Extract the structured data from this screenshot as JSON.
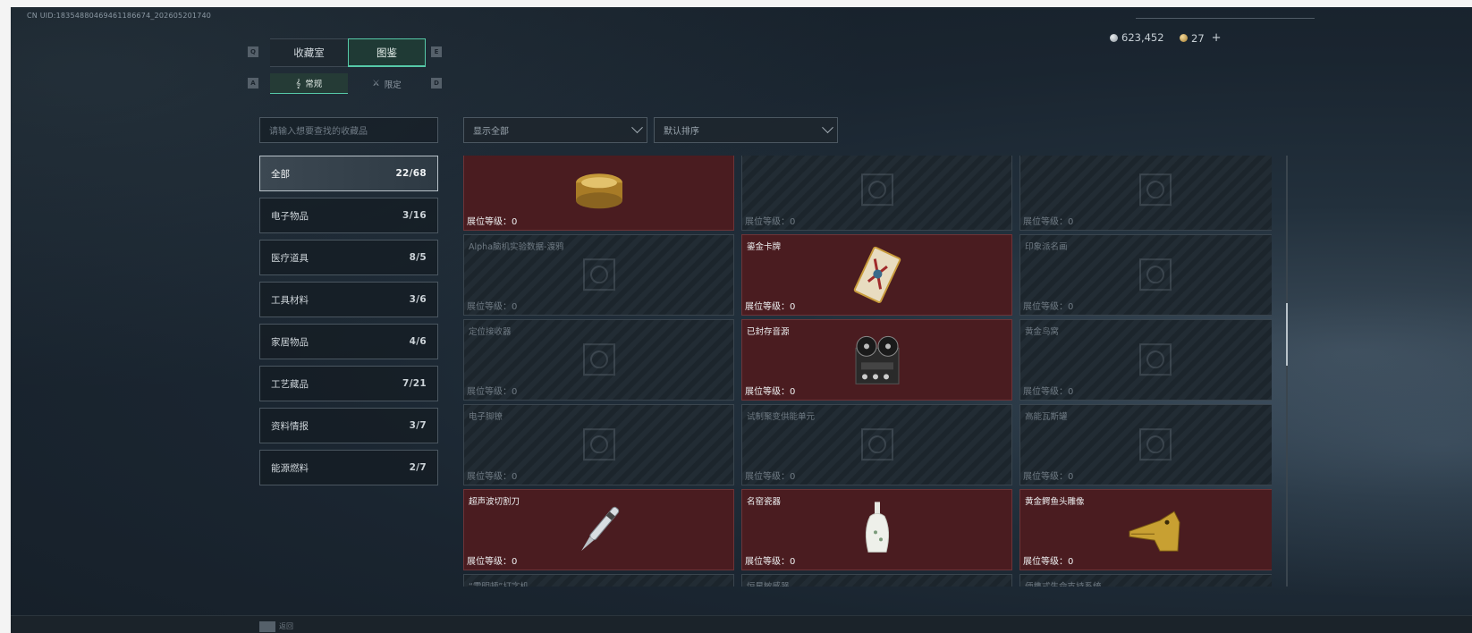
{
  "header": {
    "uid": "CN UID:1835488046946118667​4_202605201740",
    "silver": "623,452",
    "gold": "27",
    "plus": "+"
  },
  "tabs": {
    "key_left": "Q",
    "key_right": "E",
    "items": [
      {
        "label": "收藏室",
        "active": false
      },
      {
        "label": "图鉴",
        "active": true
      }
    ]
  },
  "subtabs": {
    "key_left": "A",
    "key_right": "D",
    "items": [
      {
        "label": "常规",
        "active": true
      },
      {
        "label": "限定",
        "active": false
      }
    ]
  },
  "search": {
    "placeholder": "请输入想要查找的收藏品"
  },
  "filters": {
    "show": "显示全部",
    "sort": "默认排序"
  },
  "categories": [
    {
      "label": "全部",
      "count": "22/68",
      "active": true
    },
    {
      "label": "电子物品",
      "count": "3/16"
    },
    {
      "label": "医疗道具",
      "count": "8/5"
    },
    {
      "label": "工具材料",
      "count": "3/6"
    },
    {
      "label": "家居物品",
      "count": "4/6"
    },
    {
      "label": "工艺藏品",
      "count": "7/21"
    },
    {
      "label": "资料情报",
      "count": "3/7"
    },
    {
      "label": "能源燃料",
      "count": "2/7"
    }
  ],
  "level_label": "展位等级：0",
  "cards": [
    {
      "name": "",
      "owned": true,
      "icon": "gold-box-icon"
    },
    {
      "name": "",
      "owned": false,
      "icon": "device-icon"
    },
    {
      "name": "",
      "owned": false,
      "icon": "frame-icon"
    },
    {
      "name": "Alpha脑机实验数据-渡鸦",
      "owned": false,
      "icon": "data-drive-icon"
    },
    {
      "name": "鎏金卡牌",
      "owned": true,
      "icon": "gilded-card-icon"
    },
    {
      "name": "印象派名画",
      "owned": false,
      "icon": "painting-icon"
    },
    {
      "name": "定位接收器",
      "owned": false,
      "icon": "receiver-icon"
    },
    {
      "name": "已封存音源",
      "owned": true,
      "icon": "reel-recorder-icon"
    },
    {
      "name": "黄金鸟窝",
      "owned": false,
      "icon": "gold-nest-icon"
    },
    {
      "name": "电子脚镣",
      "owned": false,
      "icon": "ankle-monitor-icon"
    },
    {
      "name": "试制聚变供能单元",
      "owned": false,
      "icon": "fusion-unit-icon"
    },
    {
      "name": "高能瓦斯罐",
      "owned": false,
      "icon": "gas-canister-icon"
    },
    {
      "name": "超声波切割刀",
      "owned": true,
      "icon": "ultrasonic-knife-icon"
    },
    {
      "name": "名窑瓷器",
      "owned": true,
      "icon": "porcelain-vase-icon"
    },
    {
      "name": "黄金鳄鱼头雕像",
      "owned": true,
      "icon": "gold-crocodile-head-icon"
    },
    {
      "name": "“雷明顿”打字机",
      "owned": false,
      "icon": "typewriter-icon"
    },
    {
      "name": "恒星敏感器",
      "owned": false,
      "icon": "star-sensor-icon"
    },
    {
      "name": "便携式生命支持系统",
      "owned": false,
      "icon": "life-support-icon"
    }
  ],
  "footer": {
    "back": "返回"
  }
}
